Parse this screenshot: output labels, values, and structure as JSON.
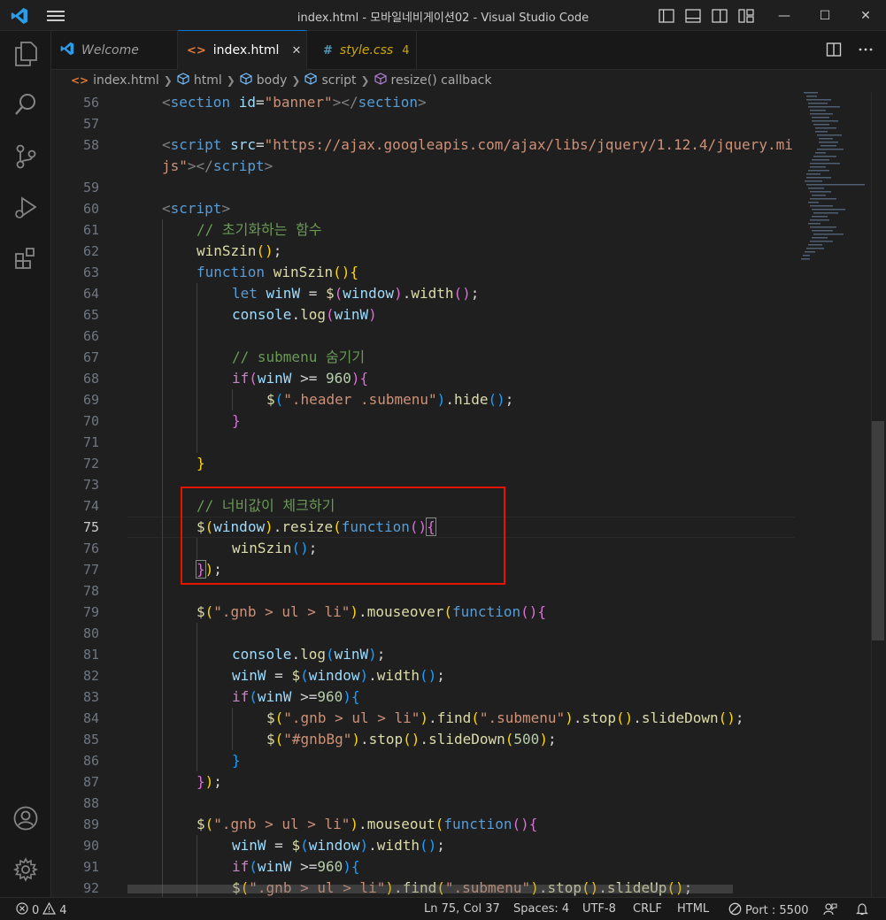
{
  "window": {
    "title": "index.html - 모바일네비게이션02 - Visual Studio Code"
  },
  "window_controls": {
    "minimize": "—",
    "maximize": "☐",
    "close": "✕"
  },
  "tabs": [
    {
      "label": "Welcome",
      "active": false,
      "italic": true
    },
    {
      "label": "index.html",
      "active": true,
      "close": "✕"
    },
    {
      "label": "style.css",
      "active": false,
      "italic": true,
      "badge": "4"
    }
  ],
  "breadcrumb": [
    "index.html",
    "html",
    "body",
    "script",
    "resize() callback"
  ],
  "editor": {
    "line_numbers": [
      56,
      57,
      58,
      "",
      59,
      60,
      61,
      62,
      63,
      64,
      65,
      66,
      67,
      68,
      69,
      70,
      71,
      72,
      73,
      74,
      75,
      76,
      77,
      78,
      79,
      80,
      81,
      82,
      83,
      84,
      85,
      86,
      87,
      88,
      89,
      90,
      91,
      92
    ],
    "current_line": 75
  },
  "code": {
    "l56": {
      "indent": "    ",
      "open": "<",
      "tag": "section",
      "attr": " id",
      "eq": "=",
      "val": "\"banner\"",
      "mid": "></",
      "tag2": "section",
      "close": ">"
    },
    "l58a": {
      "indent": "    ",
      "open": "<",
      "tag": "script",
      "attr": " src",
      "eq": "=",
      "val": "\"https://ajax.googleapis.com/ajax/libs/jquery/1.12.4/jquery.mi"
    },
    "l58b": {
      "val": "js\"",
      "mid": "></",
      "tag": "script",
      "close": ">"
    },
    "l60": {
      "indent": "    ",
      "open": "<",
      "tag": "script",
      "close": ">"
    },
    "l61": "// 초기화하는 함수",
    "l62": {
      "fn": "winSzin",
      "p": "()",
      "semi": ";"
    },
    "l63": {
      "kw": "function",
      "fn": " winSzin",
      "p": "()",
      "b": "{"
    },
    "l64": {
      "kw": "let",
      "var": " winW",
      "op": " = ",
      "fn": "$",
      "p1": "(",
      "var2": "window",
      "p2": ")",
      "dot": ".",
      "fn2": "width",
      "p3": "()",
      "semi": ";"
    },
    "l65": {
      "var": "console",
      "dot": ".",
      "fn": "log",
      "p1": "(",
      "var2": "winW",
      "p2": ")"
    },
    "l67": "// submenu 숨기기",
    "l68": {
      "kw": "if",
      "p1": "(",
      "var": "winW",
      "op": " >= ",
      "num": "960",
      "p2": ")",
      "b": "{"
    },
    "l69": {
      "fn": "$",
      "p1": "(",
      "str": "\".header .submenu\"",
      "p2": ")",
      "dot": ".",
      "fn2": "hide",
      "p3": "()",
      "semi": ";"
    },
    "l70": "}",
    "l72": "}",
    "l74": "// 너비값이 체크하기",
    "l75": {
      "fn": "$",
      "p1": "(",
      "var": "window",
      "p2": ")",
      "dot": ".",
      "fn2": "resize",
      "p3": "(",
      "kw": "function",
      "p4": "()",
      "b": "{"
    },
    "l76": {
      "fn": "winSzin",
      "p": "()",
      "semi": ";"
    },
    "l77": {
      "b": "}",
      "p": ")",
      "semi": ";"
    },
    "l79": {
      "fn": "$",
      "p1": "(",
      "str": "\".gnb > ul > li\"",
      "p2": ")",
      "dot": ".",
      "fn2": "mouseover",
      "p3": "(",
      "kw": "function",
      "p4": "()",
      "b": "{"
    },
    "l81": {
      "var": "console",
      "dot": ".",
      "fn": "log",
      "p1": "(",
      "var2": "winW",
      "p2": ")",
      "semi": ";"
    },
    "l82": {
      "var": "winW",
      "op": " = ",
      "fn": "$",
      "p1": "(",
      "var2": "window",
      "p2": ")",
      "dot": ".",
      "fn2": "width",
      "p3": "()",
      "semi": ";"
    },
    "l83": {
      "kw": "if",
      "p1": "(",
      "var": "winW",
      "op": " >=",
      "num": "960",
      "p2": ")",
      "b": "{"
    },
    "l84": {
      "fn": "$",
      "p1": "(",
      "str": "\".gnb > ul > li\"",
      "p2": ")",
      "dot": ".",
      "fn2": "find",
      "p3": "(",
      "str2": "\".submenu\"",
      "p4": ")",
      "dot2": ".",
      "fn3": "stop",
      "p5": "()",
      "dot3": ".",
      "fn4": "slideDown",
      "p6": "()",
      "semi": ";"
    },
    "l85": {
      "fn": "$",
      "p1": "(",
      "str": "\"#gnbBg\"",
      "p2": ")",
      "dot": ".",
      "fn2": "stop",
      "p3": "()",
      "dot2": ".",
      "fn3": "slideDown",
      "p4": "(",
      "num": "500",
      "p5": ")",
      "semi": ";"
    },
    "l86": "}",
    "l87": {
      "b": "}",
      "p": ")",
      "semi": ";"
    },
    "l89": {
      "fn": "$",
      "p1": "(",
      "str": "\".gnb > ul > li\"",
      "p2": ")",
      "dot": ".",
      "fn2": "mouseout",
      "p3": "(",
      "kw": "function",
      "p4": "()",
      "b": "{"
    },
    "l90": {
      "var": "winW",
      "op": " = ",
      "fn": "$",
      "p1": "(",
      "var2": "window",
      "p2": ")",
      "dot": ".",
      "fn2": "width",
      "p3": "()",
      "semi": ";"
    },
    "l91": {
      "kw": "if",
      "p1": "(",
      "var": "winW",
      "op": " >=",
      "num": "960",
      "p2": ")",
      "b": "{"
    },
    "l92": {
      "fn": "$",
      "p1": "(",
      "str": "\".gnb > ul > li\"",
      "p2": ")",
      "dot": ".",
      "fn2": "find",
      "p3": "(",
      "str2": "\".submenu\"",
      "p4": ")",
      "dot2": ".",
      "fn3": "stop",
      "p5": "()",
      "dot3": ".",
      "fn4": "slideUp",
      "p6": "()",
      "semi": ";"
    }
  },
  "statusbar": {
    "errors": "0",
    "warnings": "4",
    "position": "Ln 75, Col 37",
    "spaces": "Spaces: 4",
    "encoding": "UTF-8",
    "eol": "CRLF",
    "language": "HTML",
    "port": "Port : 5500"
  },
  "colors": {
    "accent": "#0078d4",
    "highlight_box": "#e51400",
    "background": "#1f1f1f"
  },
  "icons": [
    "vscode-logo-icon",
    "menu-icon",
    "files-icon",
    "search-icon",
    "source-control-icon",
    "run-debug-icon",
    "extensions-icon",
    "account-icon",
    "gear-icon",
    "split-editor-icon",
    "more-icon",
    "error-icon",
    "warning-icon",
    "broadcast-icon",
    "feedback-icon",
    "bell-icon"
  ]
}
